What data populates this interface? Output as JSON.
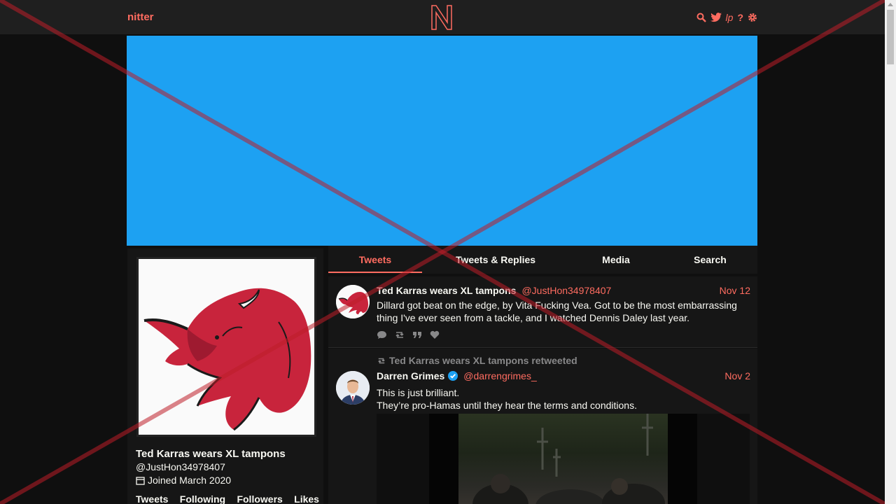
{
  "navbar": {
    "brand": "nitter",
    "icons": [
      "search-icon",
      "twitter-bird-icon",
      "rss-icon",
      "help-icon",
      "gear-icon"
    ],
    "lp_label": "lp",
    "help_label": "?"
  },
  "colors": {
    "accent": "#ff6c60",
    "banner": "#1da1f2",
    "background": "#0f0f0f",
    "panel": "#161616"
  },
  "profile": {
    "fullname": "Ted Karras wears XL tampons",
    "username": "@JustHon34978407",
    "joindate": "Joined March 2020",
    "stats": [
      "Tweets",
      "Following",
      "Followers",
      "Likes"
    ]
  },
  "tabs": [
    "Tweets",
    "Tweets & Replies",
    "Media",
    "Search"
  ],
  "tweets": [
    {
      "name": "Ted Karras wears XL tampons",
      "handle": "@JustHon34978407",
      "date": "Nov 12",
      "text": "Dillard got beat on the edge, by Vita Fucking Vea. Got to be the most embarrassing thing I've ever seen from a tackle, and I watched Dennis Daley last year."
    },
    {
      "retweet_header": "Ted Karras wears XL tampons retweeted",
      "name": "Darren Grimes",
      "handle": "@darrengrimes_",
      "date": "Nov 2",
      "text_line1": "This is just brilliant.",
      "text_line2": "They’re pro-Hamas until they hear the terms and conditions."
    }
  ]
}
